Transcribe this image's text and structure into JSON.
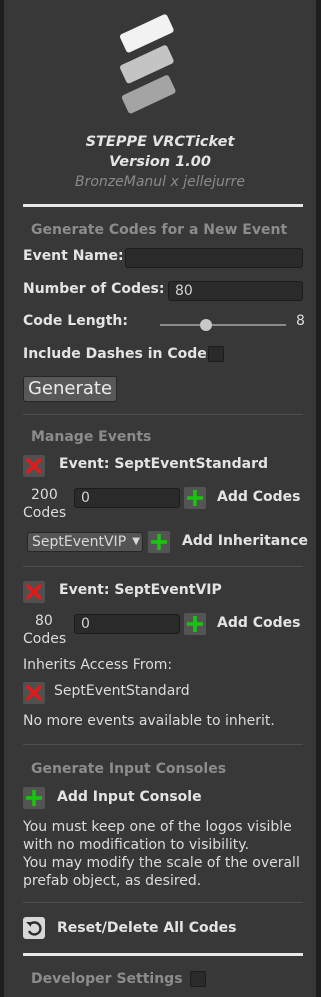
{
  "header": {
    "title": "STEPPE VRCTicket",
    "version": "Version 1.00",
    "credits": "BronzeManul x jellejurre"
  },
  "new_event": {
    "section_title": "Generate Codes for a New Event",
    "event_name_label": "Event Name:",
    "event_name_value": "",
    "num_codes_label": "Number of Codes:",
    "num_codes_value": "80",
    "code_length_label": "Code Length:",
    "code_length_value": "8",
    "code_length_slider_fraction": 0.35,
    "dashes_label": "Include Dashes in Code",
    "dashes_checked": false,
    "generate_label": "Generate"
  },
  "manage": {
    "section_title": "Manage Events",
    "events": [
      {
        "name": "Event: SeptEventStandard",
        "count": "200",
        "count_unit": "Codes",
        "add_value": "0",
        "add_codes_label": "Add Codes",
        "inherit_dropdown": "SeptEventVIP",
        "add_inheritance_label": "Add Inheritance"
      },
      {
        "name": "Event: SeptEventVIP",
        "count": "80",
        "count_unit": "Codes",
        "add_value": "0",
        "add_codes_label": "Add Codes",
        "inherits_label": "Inherits Access From:",
        "inherits_item": "SeptEventStandard",
        "no_more_text": "No more events available to inherit."
      }
    ]
  },
  "consoles": {
    "section_title": "Generate Input Consoles",
    "add_label": "Add Input Console",
    "note": "You must keep one of the logos visible with no modification to visibility.\nYou may modify the scale of the overall prefab object, as desired."
  },
  "reset": {
    "label": "Reset/Delete All Codes"
  },
  "developer": {
    "section_title": "Developer Settings",
    "checked": false
  },
  "colors": {
    "panel": "#383838",
    "x_red": "#e21a1a",
    "plus_green": "#16c60c"
  }
}
